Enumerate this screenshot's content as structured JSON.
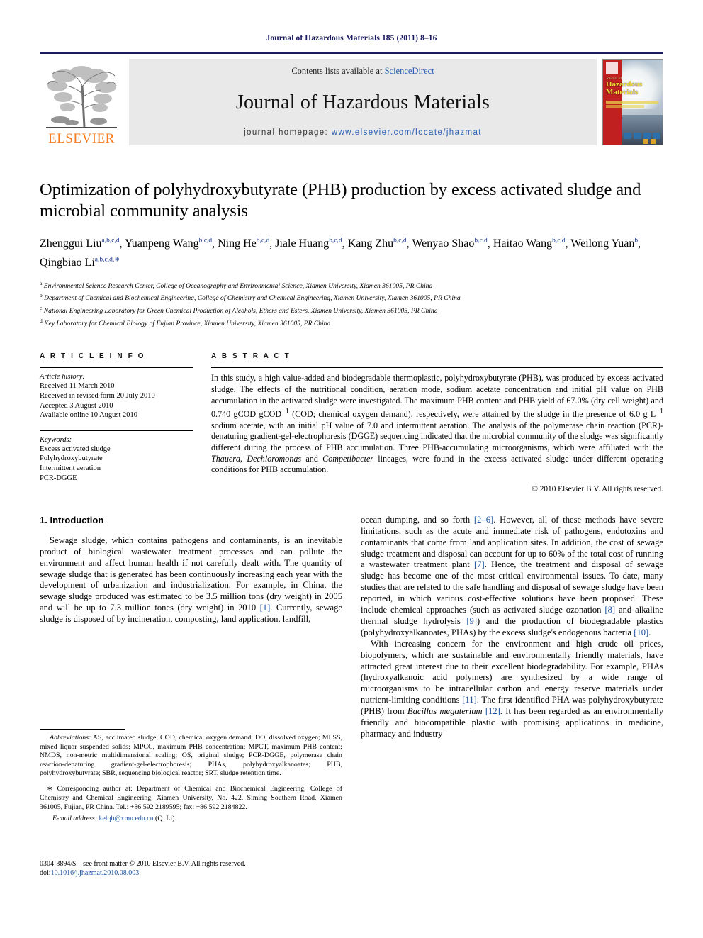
{
  "running_head": "Journal of Hazardous Materials 185 (2011) 8–16",
  "masthead": {
    "publisher_word": "ELSEVIER",
    "contents_prefix": "Contents lists available at",
    "sciencedirect": "ScienceDirect",
    "journal_name": "Journal of Hazardous Materials",
    "homepage_label": "journal homepage:",
    "homepage_url": "www.elsevier.com/locate/jhazmat",
    "cover": {
      "title_line1": "Journal of",
      "title_line2": "Hazardous",
      "title_line3": "Materials"
    }
  },
  "article": {
    "title": "Optimization of polyhydroxybutyrate (PHB) production by excess activated sludge and microbial community analysis",
    "authors": [
      {
        "name": "Zhenggui Liu",
        "sup": "a,b,c,d"
      },
      {
        "name": "Yuanpeng Wang",
        "sup": "b,c,d"
      },
      {
        "name": "Ning He",
        "sup": "b,c,d"
      },
      {
        "name": "Jiale Huang",
        "sup": "b,c,d"
      },
      {
        "name": "Kang Zhu",
        "sup": "b,c,d"
      },
      {
        "name": "Wenyao Shao",
        "sup": "b,c,d"
      },
      {
        "name": "Haitao Wang",
        "sup": "b,c,d"
      },
      {
        "name": "Weilong Yuan",
        "sup": "b"
      },
      {
        "name": "Qingbiao Li",
        "sup": "a,b,c,d,∗"
      }
    ],
    "affiliations": [
      {
        "mark": "a",
        "text": "Environmental Science Research Center, College of Oceanography and Environmental Science, Xiamen University, Xiamen 361005, PR China"
      },
      {
        "mark": "b",
        "text": "Department of Chemical and Biochemical Engineering, College of Chemistry and Chemical Engineering, Xiamen University, Xiamen 361005, PR China"
      },
      {
        "mark": "c",
        "text": "National Engineering Laboratory for Green Chemical Production of Alcohols, Ethers and Esters, Xiamen University, Xiamen 361005, PR China"
      },
      {
        "mark": "d",
        "text": "Key Laboratory for Chemical Biology of Fujian Province, Xiamen University, Xiamen 361005, PR China"
      }
    ]
  },
  "article_info": {
    "heading": "A R T I C L E   I N F O",
    "history_title": "Article history:",
    "history": [
      "Received 11 March 2010",
      "Received in revised form 20 July 2010",
      "Accepted 3 August 2010",
      "Available online 10 August 2010"
    ],
    "keywords_title": "Keywords:",
    "keywords": [
      "Excess activated sludge",
      "Polyhydroxybutyrate",
      "Intermittent aeration",
      "PCR-DGGE"
    ]
  },
  "abstract": {
    "heading": "A B S T R A C T",
    "paragraph_1": "In this study, a high value-added and biodegradable thermoplastic, polyhydroxybutyrate (PHB), was produced by excess activated sludge. The effects of the nutritional condition, aeration mode, sodium acetate concentration and initial pH value on PHB accumulation in the activated sludge were investigated. The maximum PHB content and PHB yield of 67.0% (dry cell weight) and 0.740 gCOD gCOD",
    "sup_1": "−1",
    "paragraph_2": " (COD; chemical oxygen demand), respectively, were attained by the sludge in the presence of 6.0 g L",
    "sup_2": "−1",
    "paragraph_3": " sodium acetate, with an initial pH value of 7.0 and intermittent aeration. The analysis of the polymerase chain reaction (PCR)-denaturing gradient-gel-electrophoresis (DGGE) sequencing indicated that the microbial community of the sludge was significantly different during the process of PHB accumulation. Three PHB-accumulating microorganisms, which were affiliated with the ",
    "italic_1": "Thauera",
    "paragraph_4": ", ",
    "italic_2": "Dechloromonas",
    "paragraph_5": " and ",
    "italic_3": "Competibacter",
    "paragraph_6": " lineages, were found in the excess activated sludge under different operating conditions for PHB accumulation.",
    "copyright": "© 2010 Elsevier B.V. All rights reserved."
  },
  "introduction": {
    "heading": "1.  Introduction",
    "left_p1_a": "Sewage sludge, which contains pathogens and contaminants, is an inevitable product of biological wastewater treatment processes and can pollute the environment and affect human health if not carefully dealt with. The quantity of sewage sludge that is generated has been continuously increasing each year with the development of urbanization and industrialization. For example, in China, the sewage sludge produced was estimated to be 3.5 million tons (dry weight) in 2005 and will be up to 7.3 million tones (dry weight) in 2010 ",
    "ref_1": "[1]",
    "left_p1_b": ". Currently, sewage sludge is disposed of by incineration, composting, land application, landfill,",
    "right_p1_a": "ocean dumping, and so forth ",
    "ref_2": "[2–6]",
    "right_p1_b": ". However, all of these methods have severe limitations, such as the acute and immediate risk of pathogens, endotoxins and contaminants that come from land application sites. In addition, the cost of sewage sludge treatment and disposal can account for up to 60% of the total cost of running a wastewater treatment plant ",
    "ref_3": "[7]",
    "right_p1_c": ". Hence, the treatment and disposal of sewage sludge has become one of the most critical environmental issues. To date, many studies that are related to the safe handling and disposal of sewage sludge have been reported, in which various cost-effective solutions have been proposed. These include chemical approaches (such as activated sludge ozonation ",
    "ref_4": "[8]",
    "right_p1_d": " and alkaline thermal sludge hydrolysis ",
    "ref_5": "[9]",
    "right_p1_e": ") and the production of biodegradable plastics (polyhydroxyalkanoates, PHAs) by the excess sludge's endogenous bacteria ",
    "ref_6": "[10]",
    "right_p1_f": ".",
    "right_p2_a": "With increasing concern for the environment and high crude oil prices, biopolymers, which are sustainable and environmentally friendly materials, have attracted great interest due to their excellent biodegradability. For example, PHAs (hydroxyalkanoic acid polymers) are synthesized by a wide range of microorganisms to be intracellular carbon and energy reserve materials under nutrient-limiting conditions ",
    "ref_7": "[11]",
    "right_p2_b": ". The first identified PHA was polyhydroxybutyrate (PHB) from ",
    "italic_species": "Bacillus megaterium",
    "right_p2_c": " ",
    "ref_8": "[12]",
    "right_p2_d": ". It has been regarded as an environmentally friendly and biocompatible plastic with promising applications in medicine, pharmacy and industry"
  },
  "footnotes": {
    "abbrev_title": "Abbreviations:",
    "abbrev_text": "  AS, acclimated sludge; COD, chemical oxygen demand; DO, dissolved oxygen; MLSS, mixed liquor suspended solids; MPCC, maximum PHB concentration; MPCT, maximum PHB content; NMDS, non-metric multidimensional scaling; OS, original sludge; PCR-DGGE, polymerase chain reaction-denaturing gradient-gel-electrophoresis; PHAs, polyhydroxyalkanoates; PHB, polyhydroxybutyrate; SBR, sequencing biological reactor; SRT, sludge retention time.",
    "corresponding": "∗ Corresponding author at: Department of Chemical and Biochemical Engineering, College of Chemistry and Chemical Engineering, Xiamen University, No. 422, Siming Southern Road, Xiamen 361005, Fujian, PR China. Tel.: +86 592 2189595; fax: +86 592 2184822.",
    "email_label": "E-mail address:",
    "email": "kelqb@xmu.edu.cn",
    "email_owner": "(Q. Li)."
  },
  "imprint": {
    "issn_line": "0304-3894/$ – see front matter © 2010 Elsevier B.V. All rights reserved.",
    "doi_label": "doi:",
    "doi": "10.1016/j.jhazmat.2010.08.003"
  }
}
